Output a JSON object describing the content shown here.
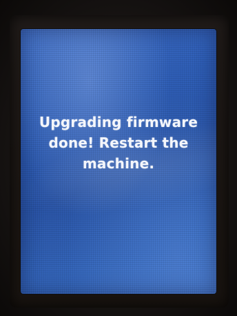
{
  "screen": {
    "message_lines": [
      "Upgrading firmware",
      "done! Restart the",
      "machine."
    ]
  },
  "colors": {
    "screen_blue": "#2f5fb8",
    "text": "#f4f6fb",
    "bezel": "#18130f"
  }
}
